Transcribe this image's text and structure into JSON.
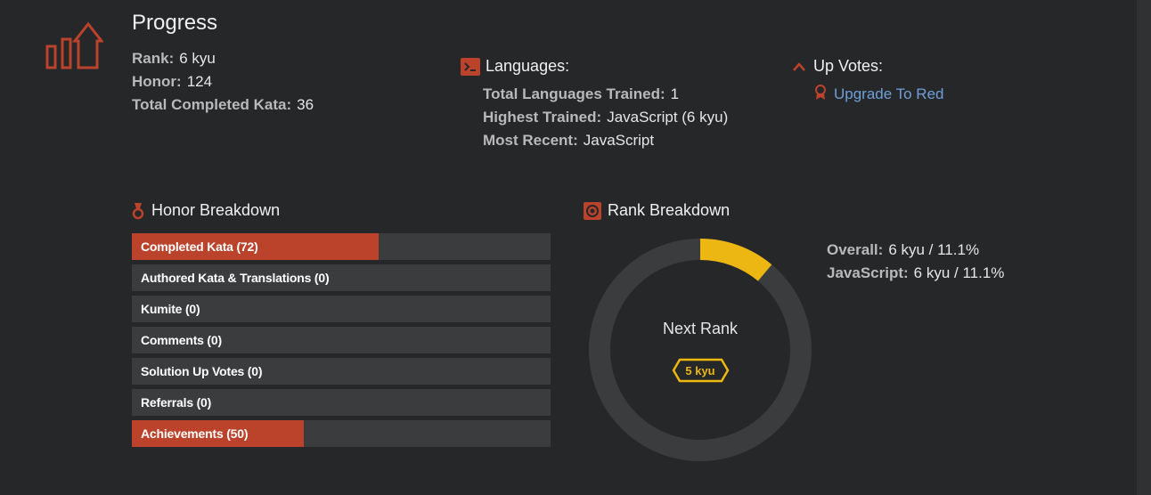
{
  "progress": {
    "title": "Progress",
    "rank_label": "Rank:",
    "rank_value": "6 kyu",
    "honor_label": "Honor:",
    "honor_value": "124",
    "completed_label": "Total Completed Kata:",
    "completed_value": "36"
  },
  "languages": {
    "title": "Languages:",
    "trained_label": "Total Languages Trained:",
    "trained_value": "1",
    "highest_label": "Highest Trained:",
    "highest_value": "JavaScript (6 kyu)",
    "recent_label": "Most Recent:",
    "recent_value": "JavaScript"
  },
  "upvotes": {
    "title": "Up Votes:",
    "link": "Upgrade To Red"
  },
  "honor_breakdown": {
    "title": "Honor Breakdown",
    "items": [
      {
        "label": "Completed Kata (72)",
        "fraction": 0.59
      },
      {
        "label": "Authored Kata & Translations (0)",
        "fraction": 0
      },
      {
        "label": "Kumite (0)",
        "fraction": 0
      },
      {
        "label": "Comments (0)",
        "fraction": 0
      },
      {
        "label": "Solution Up Votes (0)",
        "fraction": 0
      },
      {
        "label": "Referrals (0)",
        "fraction": 0
      },
      {
        "label": "Achievements (50)",
        "fraction": 0.41
      }
    ]
  },
  "rank_breakdown": {
    "title": "Rank Breakdown",
    "progress_fraction": 0.111,
    "next_rank_label": "Next Rank",
    "next_rank_badge": "5 kyu",
    "overall_label": "Overall:",
    "overall_value": "6 kyu / 11.1%",
    "js_label": "JavaScript:",
    "js_value": "6 kyu / 11.1%"
  },
  "colors": {
    "accent_red": "#bb432c",
    "rank_yellow": "#ecb613",
    "track": "#3b3c3e",
    "link": "#6f9fd8"
  }
}
